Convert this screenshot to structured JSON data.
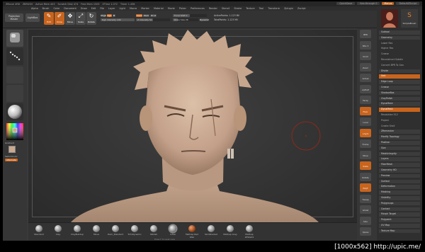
{
  "titlebar": {
    "items": [
      "ZBrush 4R6",
      "ZBRUSH",
      "Active Mem 443",
      "Scratch Disk 474",
      "Free Mem 1505",
      "ZTime 1.072",
      "Timer 1.436"
    ],
    "quicksave": "QuickSave",
    "seethrough": "See-through 0",
    "menus_label": "Menus",
    "script": "DefaultZScript"
  },
  "menubar": {
    "items": [
      "Alpha",
      "Brush",
      "Color",
      "Document",
      "Draw",
      "Edit",
      "File",
      "Layer",
      "Light",
      "Macro",
      "Marker",
      "Material",
      "Movie",
      "Picker",
      "Preferences",
      "Render",
      "Stencil",
      "Stroke",
      "Texture",
      "Tool",
      "Transform",
      "Zplugin",
      "Zscript"
    ]
  },
  "shelf": {
    "projection_master": "Projection Master",
    "lightbox": "LightBox",
    "tools": [
      {
        "label": "Edit",
        "glyph": "✎"
      },
      {
        "label": "Draw",
        "glyph": "✐"
      },
      {
        "label": "Move",
        "glyph": "✥"
      },
      {
        "label": "Scale",
        "glyph": "⤢"
      },
      {
        "label": "Rotate",
        "glyph": "↻"
      }
    ],
    "mrgb": "Mrgb",
    "rgb": "Rgb",
    "m": "M",
    "zadd": "Zadd",
    "zsub": "Zsub",
    "zcut": "Zcut",
    "rgb_intensity": "Rgb Intensity 100",
    "z_intensity": "Z Intensity 51",
    "focal_shift": "Focal Shift 0",
    "draw_size": "Draw Size 26",
    "dynamic": "Dynamic",
    "active_points": "ActivePoints: 1.123 Mil",
    "total_points": "TotalPoints: 1.123 Mil"
  },
  "leftpal": {
    "gradient_label": "Gradient",
    "switch_color": "SwitchColor",
    "alternate": "Alternate"
  },
  "bottomshelf": {
    "items": [
      "Standard",
      "Clay",
      "ClayBuildup",
      "Move",
      "Dam_Standard",
      "TrimDynamic",
      "hPolish",
      "Inflat",
      "MatCap Red Wax",
      "SkinShade4",
      "MatCap Gray",
      "MatCap White01"
    ],
    "help_text": "Press F to reset view"
  },
  "righttools": {
    "items": [
      "BPR",
      "SPix 3",
      "Scroll",
      "Zoom",
      "Actual",
      "AAHalf",
      "Persp",
      "Floor",
      "Local",
      "L.Sym",
      "Frame",
      "Move",
      "Scale",
      "Rotate",
      "PolyF",
      "Transp",
      "Ghost",
      "Solo",
      "Xpose"
    ]
  },
  "tray": {
    "thumb_label": "SimpleBrush",
    "rows": [
      {
        "t": "Subtool",
        "k": "head"
      },
      {
        "t": "Geometry",
        "k": "head"
      },
      {
        "t": "Lower Res",
        "k": "sub"
      },
      {
        "t": "Higher Res",
        "k": "sub"
      },
      {
        "t": "Crease",
        "k": "sub"
      },
      {
        "t": "Reconstruct Subdiv",
        "k": "sub"
      },
      {
        "t": "Convert BPR To Geo",
        "k": "sub"
      },
      {
        "t": "Divide",
        "k": "head"
      },
      {
        "t": "Smt",
        "k": "orange"
      },
      {
        "t": "Edge Loop",
        "k": "head"
      },
      {
        "t": "Crease",
        "k": "head"
      },
      {
        "t": "ShadowBox",
        "k": "head"
      },
      {
        "t": "ClayPolish",
        "k": "head"
      },
      {
        "t": "DynaMesh",
        "k": "head"
      },
      {
        "t": "DynaMesh",
        "k": "orange"
      },
      {
        "t": "Resolution 512",
        "k": "sub"
      },
      {
        "t": "Project",
        "k": "sub"
      },
      {
        "t": "Create Shell",
        "k": "sub"
      },
      {
        "t": "ZRemesher",
        "k": "head"
      },
      {
        "t": "Modify Topology",
        "k": "head"
      },
      {
        "t": "Position",
        "k": "head"
      },
      {
        "t": "Size",
        "k": "head"
      },
      {
        "t": "MeshIntegrity",
        "k": "head"
      },
      {
        "t": "Layers",
        "k": "head"
      },
      {
        "t": "FiberMesh",
        "k": "head"
      },
      {
        "t": "Geometry HD",
        "k": "head"
      },
      {
        "t": "Preview",
        "k": "head"
      },
      {
        "t": "Surface",
        "k": "head"
      },
      {
        "t": "Deformation",
        "k": "head"
      },
      {
        "t": "Masking",
        "k": "head"
      },
      {
        "t": "Visibility",
        "k": "head"
      },
      {
        "t": "Polygroups",
        "k": "head"
      },
      {
        "t": "Contact",
        "k": "head"
      },
      {
        "t": "Morph Target",
        "k": "head"
      },
      {
        "t": "Polypaint",
        "k": "head"
      },
      {
        "t": "UV Map",
        "k": "head"
      },
      {
        "t": "Texture Map",
        "k": "head"
      }
    ]
  },
  "footer": "[1000x562] http://upic.me/",
  "colors": {
    "accent": "#c8641e",
    "skin": "#c9a990",
    "cursor_ring": "#8a2a1a"
  }
}
